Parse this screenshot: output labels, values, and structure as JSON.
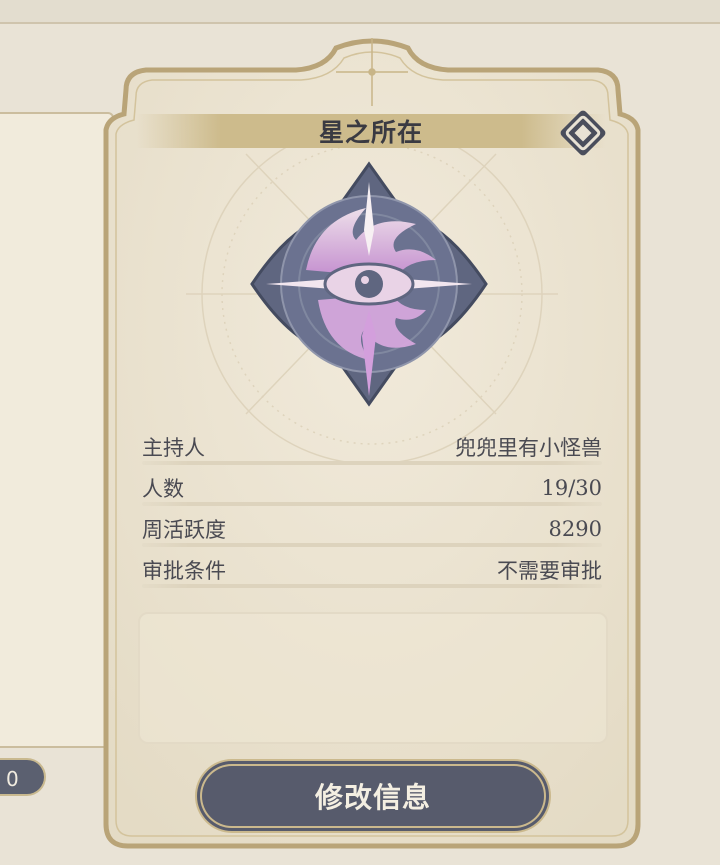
{
  "card": {
    "title": "星之所在",
    "info": [
      {
        "label": "主持人",
        "value": "兜兜里有小怪兽"
      },
      {
        "label": "人数",
        "value": "19/30"
      },
      {
        "label": "周活跃度",
        "value": "8290"
      },
      {
        "label": "审批条件",
        "value": "不需要审批"
      }
    ],
    "description": "",
    "edit_button": "修改信息"
  },
  "left_pill": {
    "value": "0"
  },
  "icons": {
    "swap": "swap-icon",
    "emblem": "guild-emblem-icon"
  },
  "colors": {
    "button_bg": "#575b6c",
    "banner_bg": "#cdbb8c",
    "card_bg": "#ece4d2",
    "gold_border": "#c2ad7c"
  }
}
